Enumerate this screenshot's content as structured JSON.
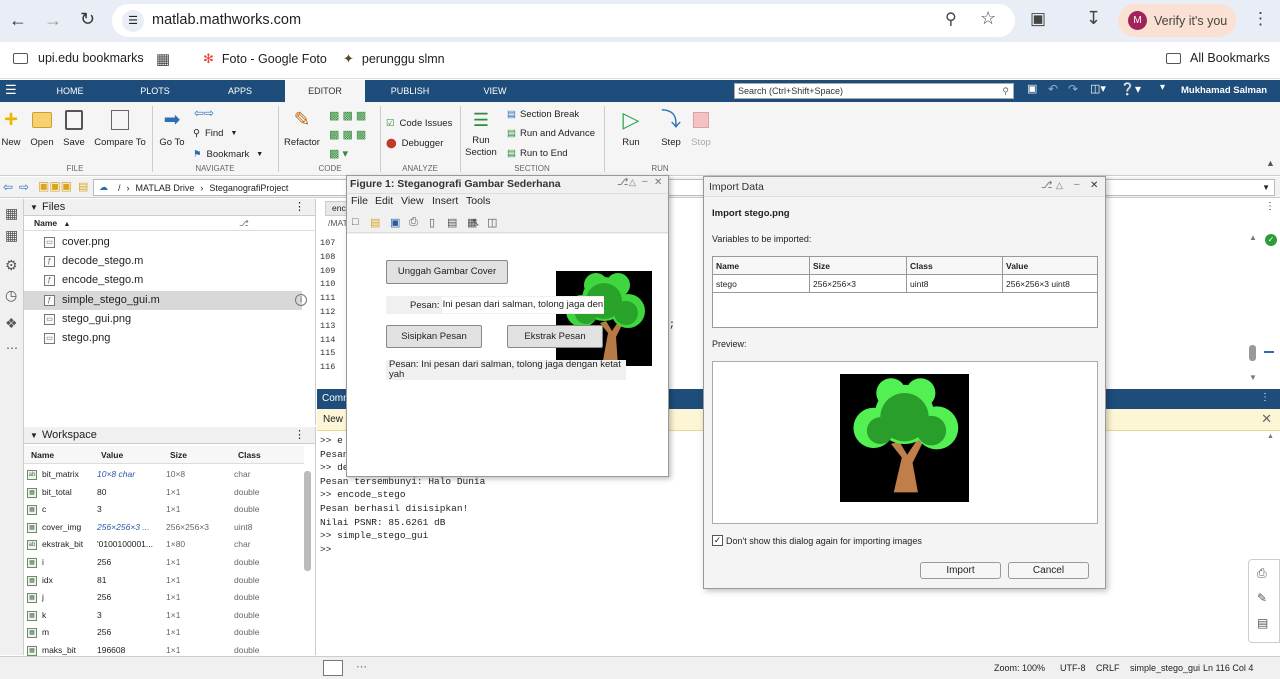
{
  "browser": {
    "url": "matlab.mathworks.com",
    "verify_label": "Verify it's you",
    "profile_initial": "M",
    "bookmarks": [
      "upi.edu bookmarks",
      "Foto - Google Foto",
      "perunggu slmn"
    ],
    "all_bookmarks": "All Bookmarks"
  },
  "matlab": {
    "tabs": [
      "HOME",
      "PLOTS",
      "APPS",
      "EDITOR",
      "PUBLISH",
      "VIEW"
    ],
    "search_placeholder": "Search (Ctrl+Shift+Space)",
    "user": "Mukhamad Salman",
    "ribbon": {
      "file": {
        "new": "New",
        "open": "Open",
        "save": "Save",
        "compare": "Compare To",
        "group": "FILE"
      },
      "navigate": {
        "goto": "Go To",
        "find": "Find",
        "bookmark": "Bookmark",
        "group": "NAVIGATE"
      },
      "code": {
        "refactor": "Refactor",
        "group": "CODE"
      },
      "analyze": {
        "code_issues": "Code Issues",
        "debugger": "Debugger",
        "group": "ANALYZE"
      },
      "section": {
        "run_section": "Run Section",
        "section_break": "Section Break",
        "run_advance": "Run and Advance",
        "run_end": "Run to End",
        "group": "SECTION"
      },
      "run": {
        "run": "Run",
        "step": "Step",
        "stop": "Stop",
        "group": "RUN"
      }
    },
    "path": [
      "MATLAB Drive",
      "SteganografiProject"
    ],
    "path_root": "/",
    "files_panel": {
      "title": "Files",
      "col_name": "Name",
      "items": [
        "cover.png",
        "decode_stego.m",
        "encode_stego.m",
        "simple_stego_gui.m",
        "stego_gui.png",
        "stego.png"
      ]
    },
    "workspace": {
      "title": "Workspace",
      "cols": [
        "Name",
        "Value",
        "Size",
        "Class"
      ],
      "rows": [
        {
          "name": "bit_matrix",
          "value": "10×8 char",
          "size": "10×8",
          "class": "char"
        },
        {
          "name": "bit_total",
          "value": "80",
          "size": "1×1",
          "class": "double"
        },
        {
          "name": "c",
          "value": "3",
          "size": "1×1",
          "class": "double"
        },
        {
          "name": "cover_img",
          "value": "256×256×3 ...",
          "size": "256×256×3",
          "class": "uint8"
        },
        {
          "name": "ekstrak_bit",
          "value": "'0100100001...",
          "size": "1×80",
          "class": "char"
        },
        {
          "name": "i",
          "value": "256",
          "size": "1×1",
          "class": "double"
        },
        {
          "name": "idx",
          "value": "81",
          "size": "1×1",
          "class": "double"
        },
        {
          "name": "j",
          "value": "256",
          "size": "1×1",
          "class": "double"
        },
        {
          "name": "k",
          "value": "3",
          "size": "1×1",
          "class": "double"
        },
        {
          "name": "m",
          "value": "256",
          "size": "1×1",
          "class": "double"
        },
        {
          "name": "maks_bit",
          "value": "196608",
          "size": "1×1",
          "class": "double"
        }
      ]
    },
    "editor": {
      "tab": "enc",
      "crumb": "/MAT",
      "line_numbers": [
        "107",
        "108",
        "109",
        "110",
        "111",
        "112",
        "113",
        "114",
        "115",
        "116"
      ],
      "code_fragment": ";"
    },
    "command_window": {
      "title": "Comm",
      "new_banner": "New",
      "lines": [
        ">> e",
        "Pesan",
        ">> de",
        "Pesan tersembunyi: Halo Dunia",
        ">> encode_stego",
        "Pesan berhasil disisipkan!",
        "Nilai PSNR: 85.6261 dB",
        ">> simple_stego_gui",
        ">>"
      ]
    },
    "status": {
      "zoom": "Zoom: 100%",
      "encoding": "UTF-8",
      "eol": "CRLF",
      "file": "simple_stego_gui",
      "position": "Ln 116 Col 4"
    }
  },
  "figure": {
    "title": "Figure 1: Steganografi Gambar Sederhana",
    "menu": [
      "File",
      "Edit",
      "View",
      "Insert",
      "Tools"
    ],
    "upload_button": "Unggah Gambar Cover",
    "message_label": "Pesan:",
    "message_value": "Ini pesan dari salman, tolong jaga den",
    "embed_button": "Sisipkan Pesan",
    "extract_button": "Ekstrak Pesan",
    "result_text": "Pesan: Ini pesan dari salman, tolong jaga dengan ketat yah"
  },
  "import_dialog": {
    "title": "Import Data",
    "heading": "Import stego.png",
    "vars_label": "Variables to be imported:",
    "cols": [
      "Name",
      "Size",
      "Class",
      "Value"
    ],
    "row": {
      "name": "stego",
      "size": "256×256×3",
      "class": "uint8",
      "value": "256×256×3 uint8"
    },
    "preview_label": "Preview:",
    "checkbox_label": "Don't show this dialog again for importing images",
    "checkbox_checked": true,
    "import_button": "Import",
    "cancel_button": "Cancel"
  }
}
